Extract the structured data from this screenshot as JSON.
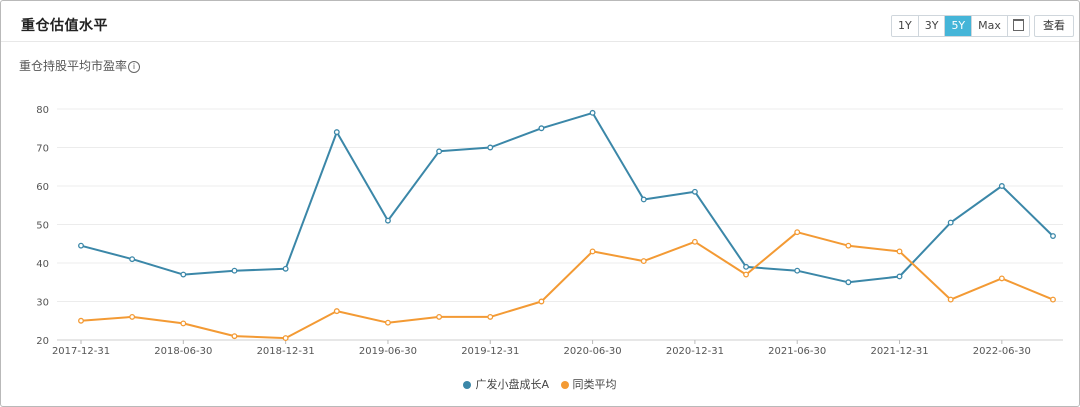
{
  "header": {
    "title": "重仓估值水平",
    "range_buttons": [
      {
        "label": "1Y",
        "active": false
      },
      {
        "label": "3Y",
        "active": false
      },
      {
        "label": "5Y",
        "active": true
      },
      {
        "label": "Max",
        "active": false
      }
    ],
    "calendar_icon": "calendar-icon",
    "view_button": "查看"
  },
  "subtitle": "重仓持股平均市盈率",
  "info_icon": "info-icon",
  "colors": {
    "series_1": "#3b87a8",
    "series_2": "#f39a34",
    "active_button": "#45b5d8"
  },
  "chart_data": {
    "type": "line",
    "x": [
      "2017-12-31",
      "2018-03-31",
      "2018-06-30",
      "2018-09-30",
      "2018-12-31",
      "2019-03-31",
      "2019-06-30",
      "2019-09-30",
      "2019-12-31",
      "2020-03-31",
      "2020-06-30",
      "2020-09-30",
      "2020-12-31",
      "2021-03-31",
      "2021-06-30",
      "2021-09-30",
      "2021-12-31",
      "2022-03-31",
      "2022-06-30",
      "2022-09-30"
    ],
    "tick_labels": [
      "2017-12-31",
      "2018-06-30",
      "2018-12-31",
      "2019-06-30",
      "2019-12-31",
      "2020-06-30",
      "2020-12-31",
      "2021-06-30",
      "2021-12-31",
      "2022-06-30"
    ],
    "series": [
      {
        "name": "广发小盘成长A",
        "color": "#3b87a8",
        "values": [
          44.5,
          41.0,
          37.0,
          38.0,
          38.5,
          74.0,
          51.0,
          69.0,
          70.0,
          75.0,
          79.0,
          56.5,
          58.5,
          39.0,
          38.0,
          35.0,
          36.5,
          50.5,
          60.0,
          47.0
        ]
      },
      {
        "name": "同类平均",
        "color": "#f39a34",
        "values": [
          25.0,
          26.0,
          24.3,
          21.0,
          20.5,
          27.5,
          24.5,
          26.0,
          26.0,
          30.0,
          43.0,
          40.5,
          45.5,
          37.0,
          48.0,
          44.5,
          43.0,
          30.5,
          36.0,
          30.5
        ]
      }
    ],
    "ylim": [
      20,
      80
    ],
    "yticks": [
      20,
      30,
      40,
      50,
      60,
      70,
      80
    ],
    "grid": true,
    "legend": "bottom-center"
  }
}
